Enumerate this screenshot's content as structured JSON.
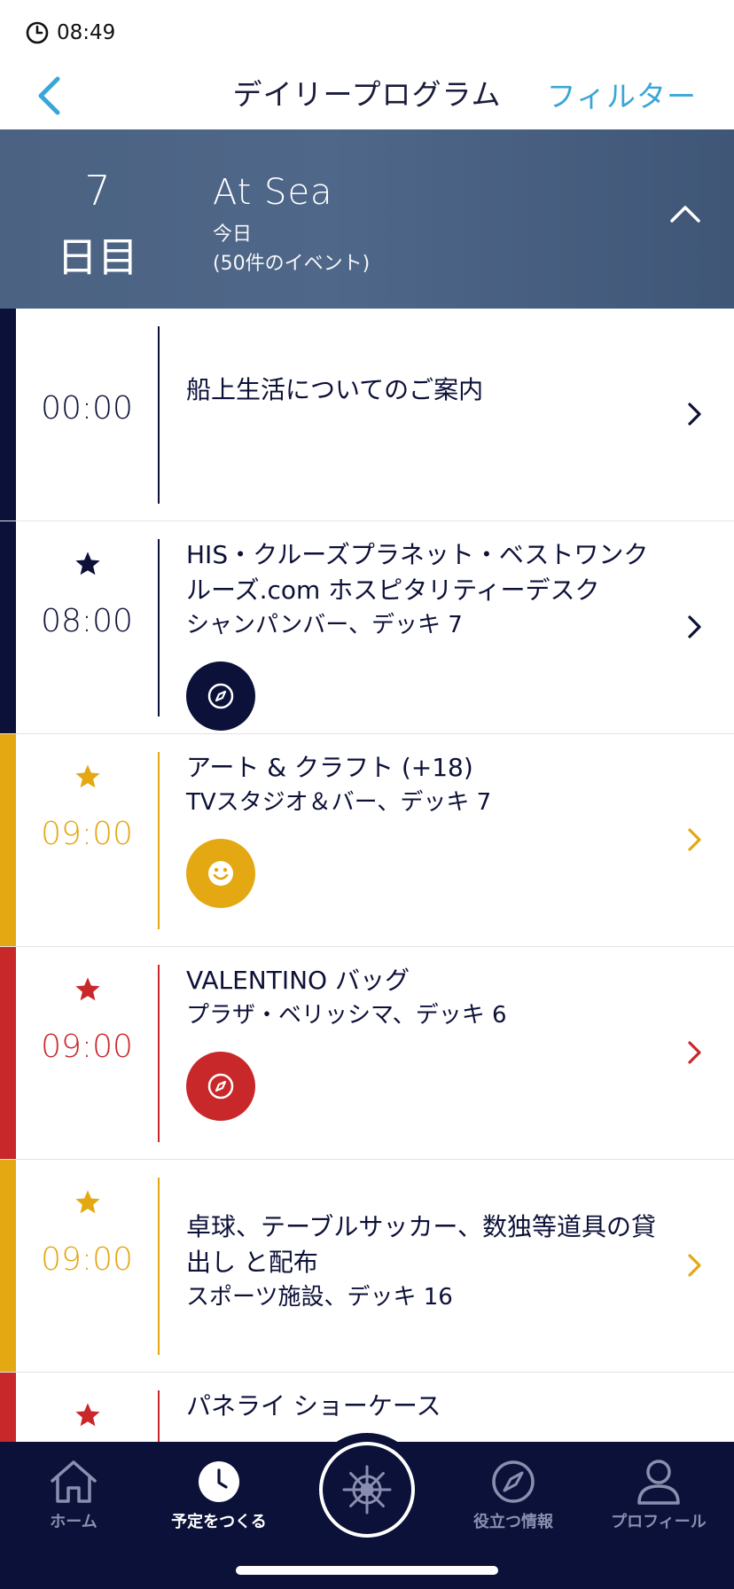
{
  "status": {
    "time": "08:49"
  },
  "nav": {
    "title": "デイリープログラム",
    "filter_label": "フィルター"
  },
  "day": {
    "number": "7",
    "suffix": "日目",
    "name": "At Sea",
    "subtitle": "今日",
    "count": "(50件のイベント)"
  },
  "colors": {
    "navy": "#0b1138",
    "gold": "#e3a812",
    "red": "#c9282a",
    "accent_blue": "#3aa6d8"
  },
  "events": [
    {
      "time": "00:00",
      "starred": false,
      "title": "船上生活についてのご案内",
      "location": "",
      "color": "#0b1138",
      "time_color": "#0d1138",
      "icon": ""
    },
    {
      "time": "08:00",
      "starred": true,
      "title": "HIS・クルーズプラネット・ベストワンクルーズ.com ホスピタリティーデスク",
      "location": "シャンパンバー、デッキ 7",
      "color": "#0b1138",
      "time_color": "#0d1138",
      "icon": "compass-icon"
    },
    {
      "time": "09:00",
      "starred": true,
      "title": "アート & クラフト (+18)",
      "location": "TVスタジオ＆バー、デッキ 7",
      "color": "#e3a812",
      "time_color": "#e3a812",
      "icon": "smiley-icon"
    },
    {
      "time": "09:00",
      "starred": true,
      "title": "VALENTINO バッグ",
      "location": "プラザ・ベリッシマ、デッキ 6",
      "color": "#c9282a",
      "time_color": "#c9282a",
      "icon": "compass-icon"
    },
    {
      "time": "09:00",
      "starred": true,
      "title": "卓球、テーブルサッカー、数独等道具の貸出し と配布",
      "location": "スポーツ施設、デッキ 16",
      "color": "#e3a812",
      "time_color": "#e3a812",
      "icon": ""
    },
    {
      "time": "",
      "starred": true,
      "title": "パネライ ショーケース",
      "location": "",
      "color": "#c9282a",
      "time_color": "#c9282a",
      "icon": ""
    }
  ],
  "tabs": [
    {
      "label": "ホーム",
      "icon": "home-icon",
      "active": false
    },
    {
      "label": "予定をつくる",
      "icon": "clock-icon",
      "active": true
    },
    {
      "label": "",
      "icon": "ship-wheel-icon",
      "active": false
    },
    {
      "label": "役立つ情報",
      "icon": "compass-icon",
      "active": false
    },
    {
      "label": "プロフィール",
      "icon": "person-icon",
      "active": false
    }
  ]
}
